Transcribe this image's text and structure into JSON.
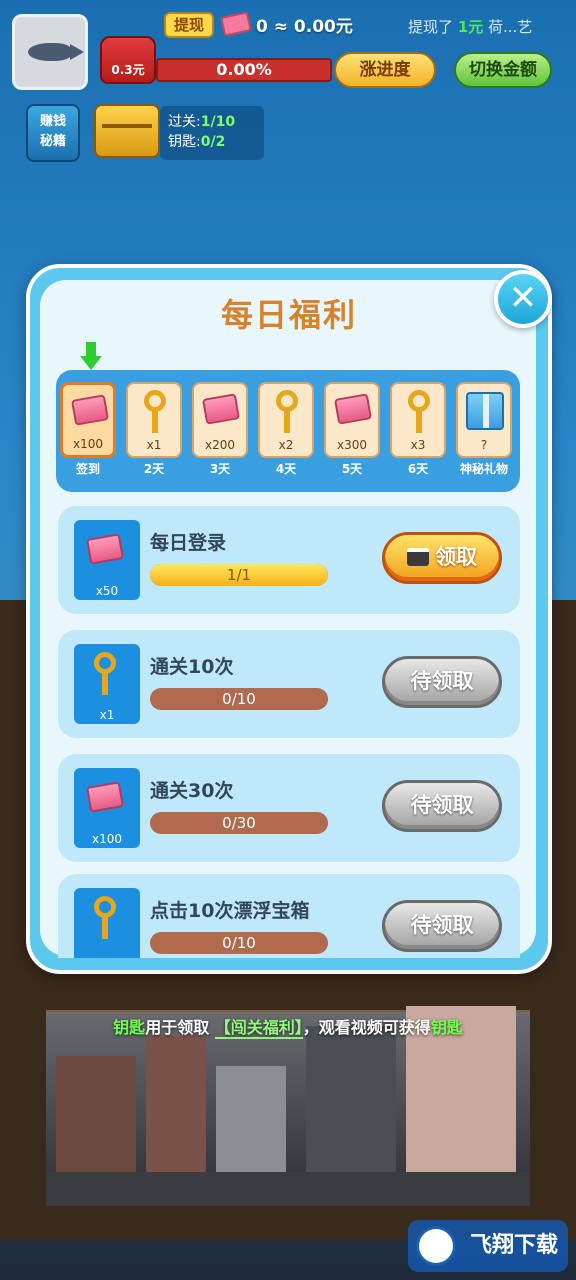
{
  "hud": {
    "withdraw_label": "提现",
    "cash_amount": "0 ≈ 0.00元",
    "notice_prefix": "提现了",
    "notice_amount": "1元",
    "notice_suffix": "荷...艺",
    "bag_label": "0.3元",
    "progress_text": "0.00%",
    "progress_fraction": 0,
    "speed_button": "涨进度",
    "switch_button": "切换金额",
    "secret_book_line1": "赚钱",
    "secret_book_line2": "秘籍",
    "level_label": "过关:",
    "level_value": "1/10",
    "key_label": "钥匙:",
    "key_value": "0/2"
  },
  "modal": {
    "title": "每日福利",
    "close_label": "✕",
    "days": [
      {
        "qty": "x100",
        "label": "签到",
        "icon": "cash-icon",
        "active": true
      },
      {
        "qty": "x1",
        "label": "2天",
        "icon": "key-icon"
      },
      {
        "qty": "x200",
        "label": "3天",
        "icon": "cash-icon"
      },
      {
        "qty": "x2",
        "label": "4天",
        "icon": "key-icon"
      },
      {
        "qty": "x300",
        "label": "5天",
        "icon": "cash-icon"
      },
      {
        "qty": "x3",
        "label": "6天",
        "icon": "key-icon"
      },
      {
        "qty": "?",
        "label": "神秘礼物",
        "icon": "gift-icon"
      }
    ],
    "tasks": [
      {
        "name": "每日登录",
        "qty": "x50",
        "icon": "cash-icon",
        "progress": "1/1",
        "fraction": 1,
        "button": "领取",
        "claimable": true
      },
      {
        "name": "通关10次",
        "qty": "x1",
        "icon": "key-icon",
        "progress": "0/10",
        "fraction": 0,
        "button": "待领取",
        "claimable": false
      },
      {
        "name": "通关30次",
        "qty": "x100",
        "icon": "cash-icon",
        "progress": "0/30",
        "fraction": 0,
        "button": "待领取",
        "claimable": false
      },
      {
        "name": "点击10次漂浮宝箱",
        "qty": "",
        "icon": "key-icon",
        "progress": "0/10",
        "fraction": 0,
        "button": "待领取",
        "claimable": false
      }
    ]
  },
  "footer": {
    "key_word": "钥匙",
    "text_mid": "用于领取",
    "link_text": "【闯关福利】",
    "text_after": "，观看视频可获得",
    "key_word_end": "钥匙"
  },
  "watermark": {
    "text": "飞翔下载"
  }
}
